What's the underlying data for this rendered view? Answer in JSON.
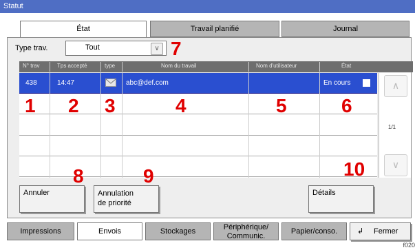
{
  "window": {
    "title": "Statut"
  },
  "tabs": [
    {
      "label": "État",
      "active": true
    },
    {
      "label": "Travail planifié",
      "active": false
    },
    {
      "label": "Journal",
      "active": false
    }
  ],
  "filter": {
    "label": "Type trav.",
    "value": "Tout"
  },
  "table": {
    "headers": [
      "N° trav",
      "Tps accepté",
      "type",
      "Nom du travail",
      "Nom d'utilisateur",
      "État"
    ],
    "rows": [
      {
        "job_no": "438",
        "time": "14:47",
        "type_icon": "envelope-icon",
        "job_name": "abc@def.com",
        "user": "",
        "status": "En cours",
        "selected": true
      }
    ],
    "page_indicator": "1/1"
  },
  "callouts": [
    "1",
    "2",
    "3",
    "4",
    "5",
    "6",
    "7",
    "8",
    "9",
    "10"
  ],
  "buttons": {
    "cancel": "Annuler",
    "priority_line1": "Annulation",
    "priority_line2": "de priorité",
    "details": "Détails"
  },
  "bottom_tabs": [
    {
      "label": "Impressions",
      "active": false
    },
    {
      "label": "Envois",
      "active": true
    },
    {
      "label": "Stockages",
      "active": false
    },
    {
      "label_line1": "Périphérique/",
      "label_line2": "Communic.",
      "active": false
    },
    {
      "label": "Papier/conso.",
      "active": false
    }
  ],
  "close_label": "Fermer",
  "figure_id": "f020",
  "colors": {
    "title_bar": "#4f6ec4",
    "selected_row": "#2a4fd0",
    "callout": "#e00000",
    "header": "#6e6e6e"
  }
}
